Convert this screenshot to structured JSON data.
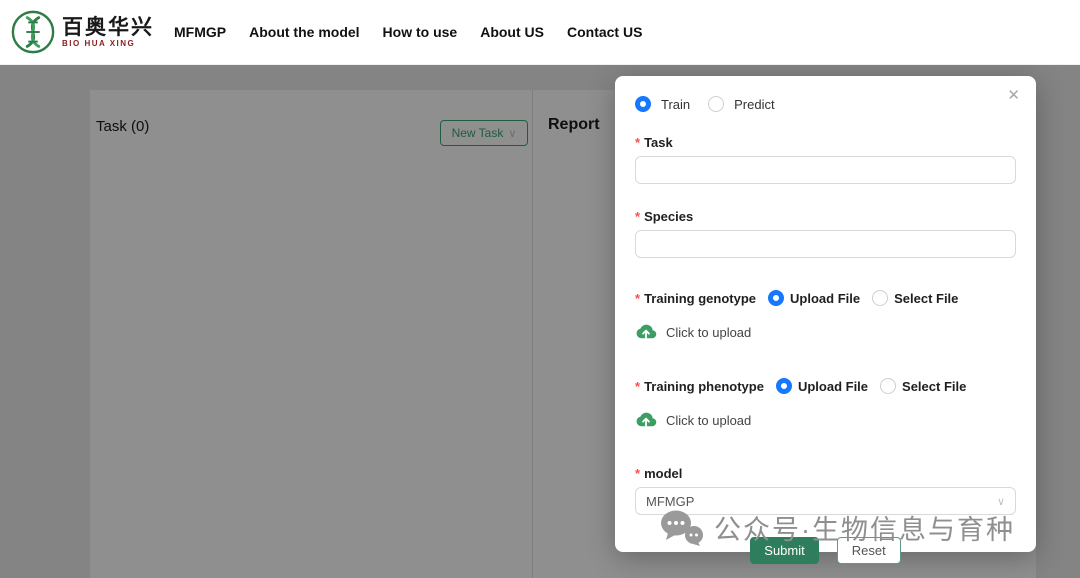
{
  "header": {
    "logo": {
      "title": "百奥华兴",
      "subtitle": "BIO HUA XING"
    },
    "nav": [
      {
        "label": "MFMGP"
      },
      {
        "label": "About the model"
      },
      {
        "label": "How to use"
      },
      {
        "label": "About US"
      },
      {
        "label": "Contact US"
      }
    ]
  },
  "panel": {
    "task_title": "Task (0)",
    "new_task_label": "New Task",
    "new_task_chevron": "∨",
    "report_title": "Report"
  },
  "modal": {
    "required_mark": "*",
    "close_icon": "✕",
    "mode": {
      "train": "Train",
      "predict": "Predict"
    },
    "fields": {
      "task": {
        "label": "Task",
        "value": ""
      },
      "species": {
        "label": "Species",
        "value": ""
      },
      "training_genotype": {
        "label": "Training genotype",
        "upload_option": "Upload File",
        "select_option": "Select File",
        "upload_text": "Click to upload"
      },
      "training_phenotype": {
        "label": "Training phenotype",
        "upload_option": "Upload File",
        "select_option": "Select File",
        "upload_text": "Click to upload"
      },
      "model": {
        "label": "model",
        "value": "MFMGP",
        "chevron": "∨"
      }
    },
    "buttons": {
      "submit": "Submit",
      "reset": "Reset"
    }
  },
  "watermark": {
    "text": "公众号·生物信息与育种"
  },
  "colors": {
    "radio_blue": "#1677ff",
    "accent_green": "#2e7e5e",
    "upload_green": "#3c9e63",
    "required_red": "#ff4d4f"
  }
}
